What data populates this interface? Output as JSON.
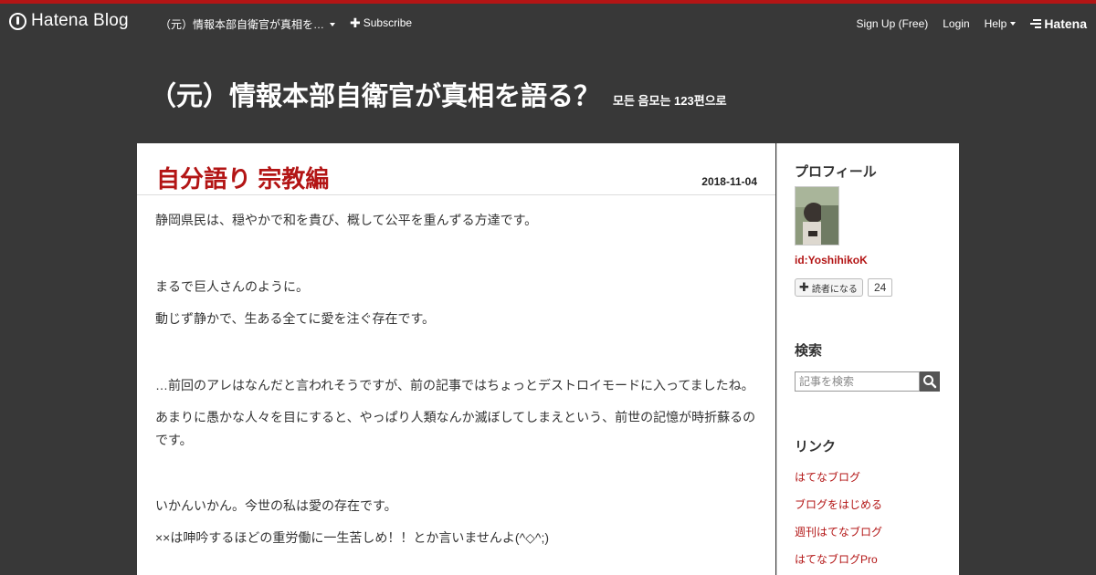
{
  "topbar": {
    "brand_name": "Hatena Blog",
    "blog_select_label": "（元）情報本部自衛官が真相を…",
    "subscribe_label": "Subscribe",
    "signup_label": "Sign Up (Free)",
    "login_label": "Login",
    "help_label": "Help",
    "hatena_label": "Hatena"
  },
  "blog": {
    "title": "（元）情報本部自衛官が真相を語る？",
    "description": "모든 음모는 123편으로"
  },
  "entry": {
    "title": "自分語り 宗教編",
    "date": "2018-11-04",
    "paragraphs": [
      "静岡県民は、穏やかで和を貴び、概して公平を重んずる方達です。",
      "まるで巨人さんのように。",
      "動じず静かで、生ある全てに愛を注ぐ存在です。",
      "…前回のアレはなんだと言われそうですが、前の記事ではちょっとデストロイモードに入ってましたね。",
      "あまりに愚かな人々を目にすると、やっぱり人類なんか滅ぼしてしまえという、前世の記憶が時折蘇るのです。",
      "いかんいかん。今世の私は愛の存在です。",
      "××は呻吟するほどの重労働に一生苦しめ！！とか言いませんよ(^◇^;)"
    ]
  },
  "sidebar": {
    "profile_title": "プロフィール",
    "user_id": "id:YoshihikoK",
    "reader_button_label": "読者になる",
    "reader_count": "24",
    "search_title": "検索",
    "search_placeholder": "記事を検索",
    "links_title": "リンク",
    "links": [
      "はてなブログ",
      "ブログをはじめる",
      "週刊はてなブログ",
      "はてなブログPro"
    ]
  },
  "colors": {
    "accent": "#b31515",
    "background": "#383838"
  }
}
